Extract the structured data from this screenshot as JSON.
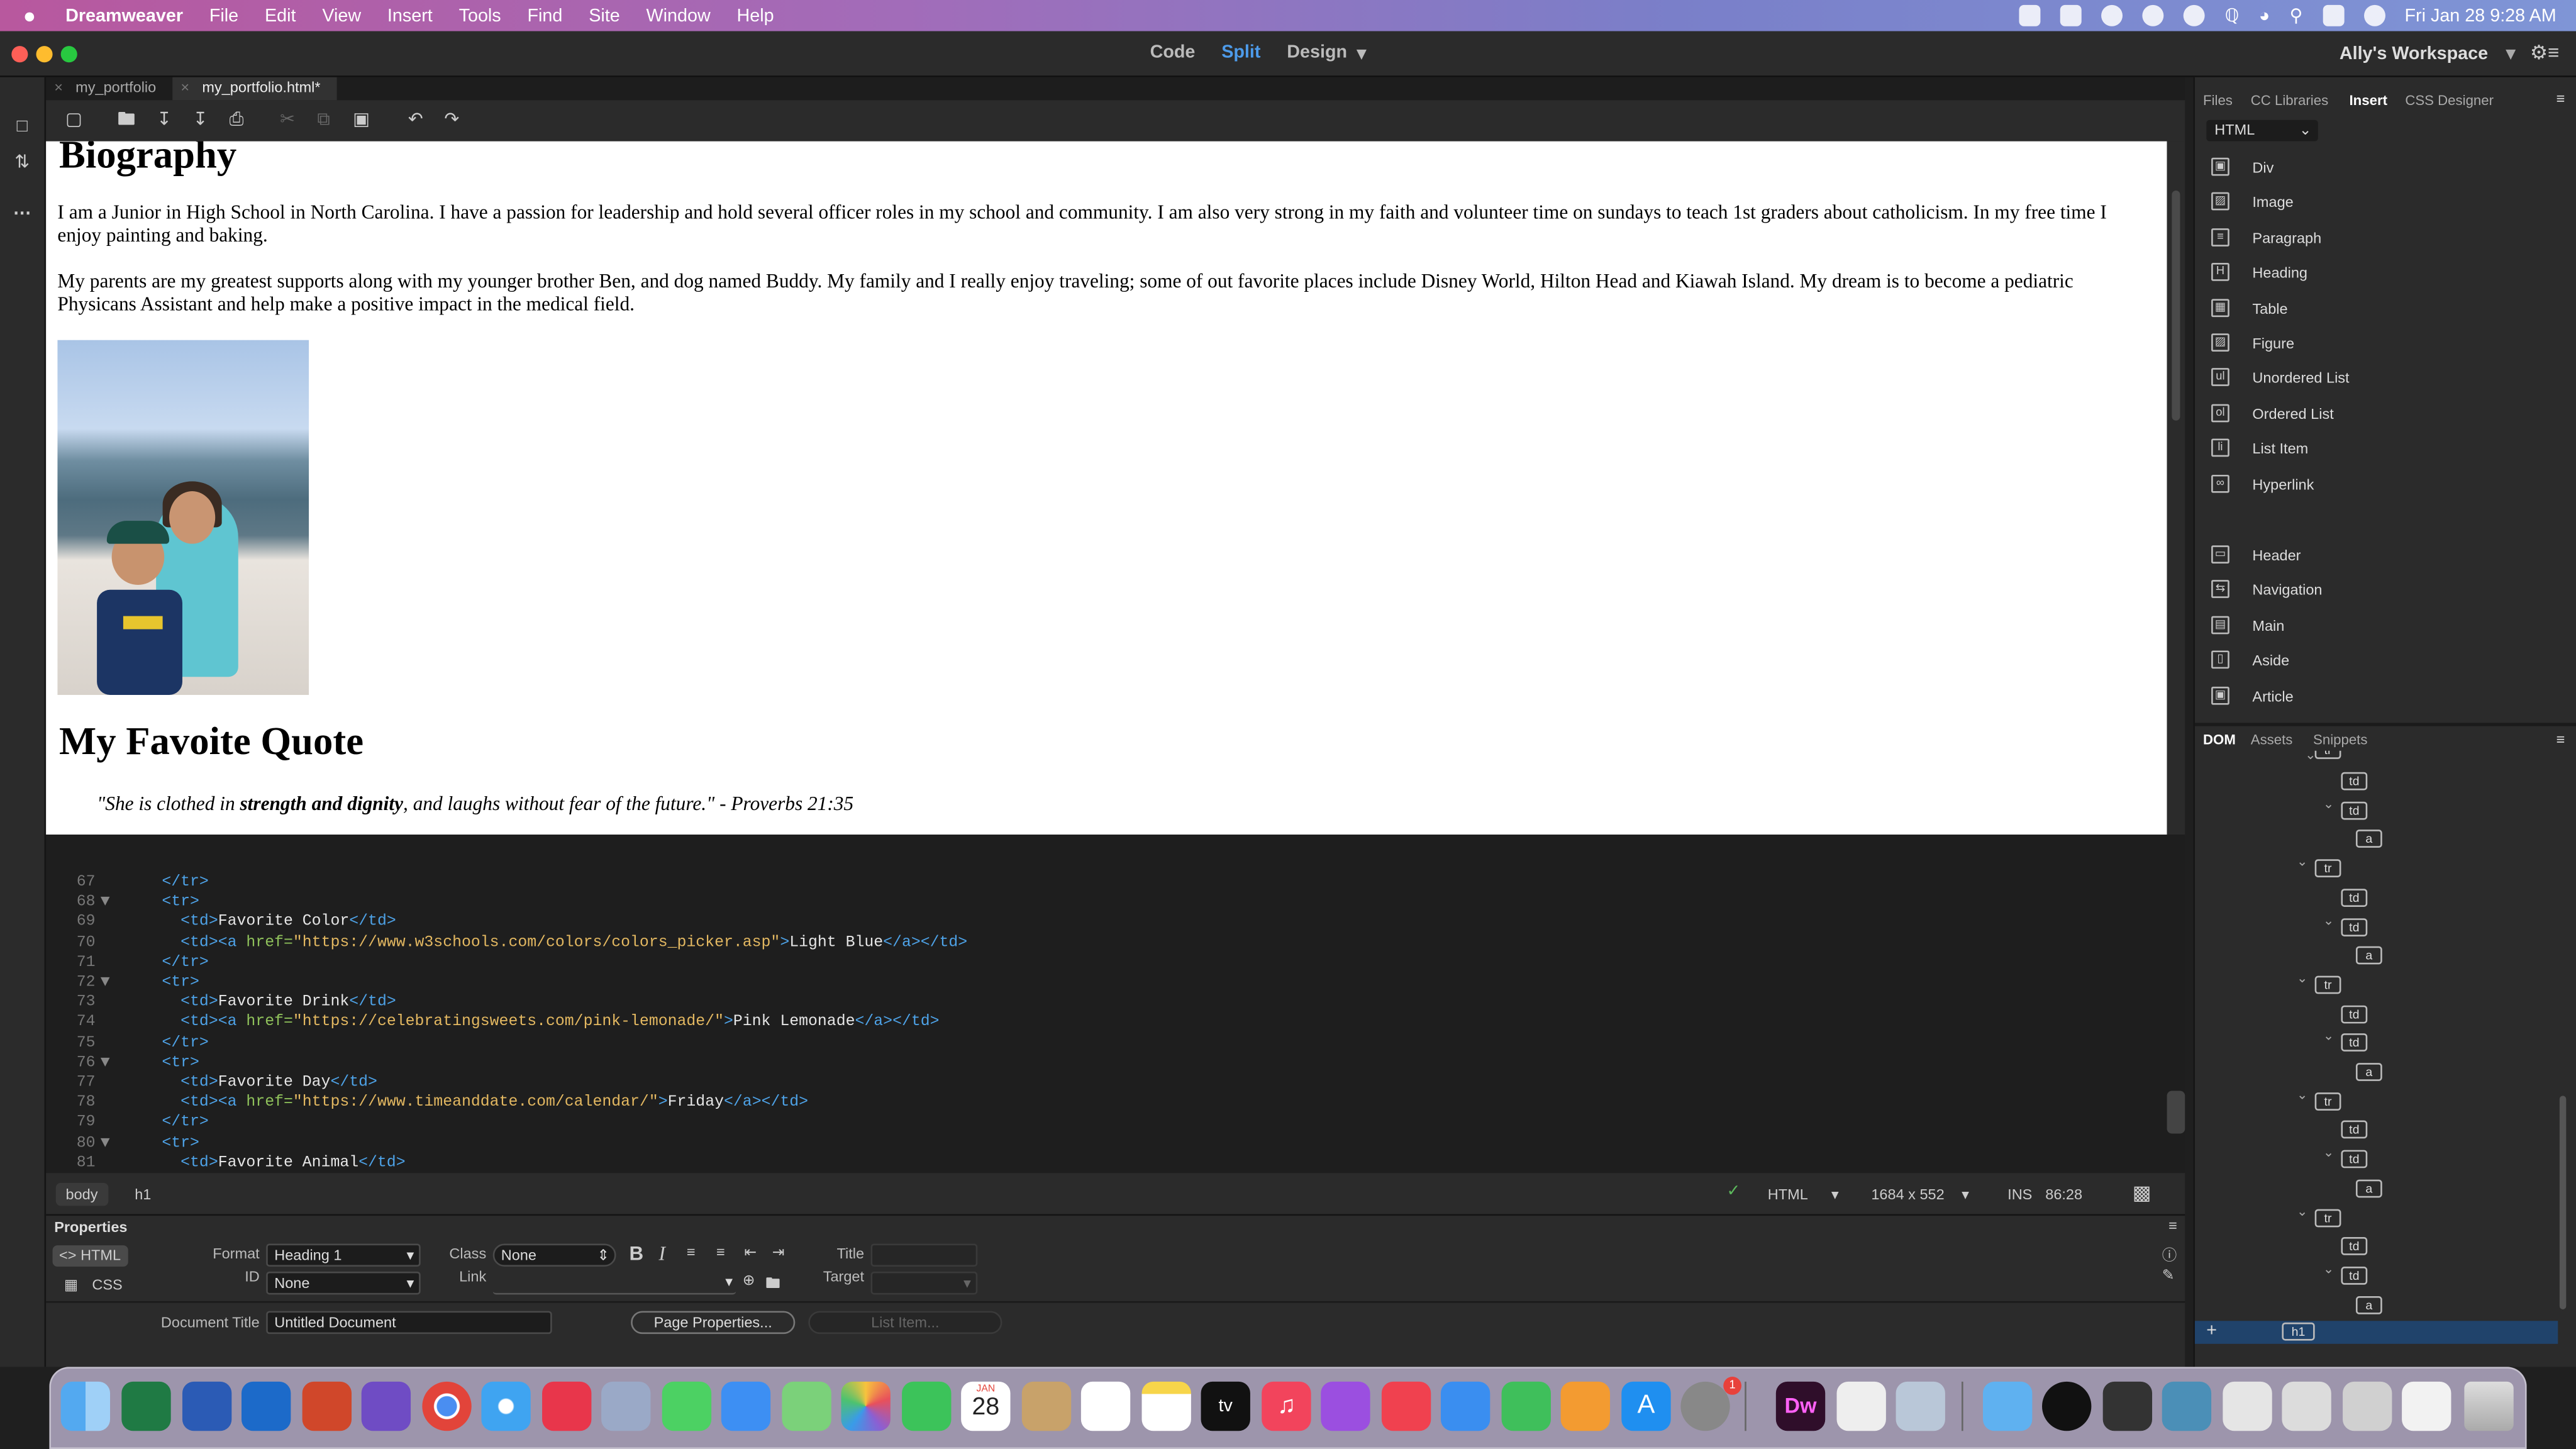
{
  "menubar": {
    "app": "Dreamweaver",
    "items": [
      "File",
      "Edit",
      "View",
      "Insert",
      "Tools",
      "Find",
      "Site",
      "Window",
      "Help"
    ],
    "clock": "Fri Jan 28  9:28 AM"
  },
  "titlebar": {
    "views": [
      "Code",
      "Split",
      "Design"
    ],
    "active_view": "Split",
    "workspace": "Ally's Workspace"
  },
  "tabs": [
    {
      "label": "my_portfolio"
    },
    {
      "label": "my_portfolio.html*"
    }
  ],
  "design": {
    "h_bio": "Biography",
    "p1": "I am a Junior in High School in North Carolina. I have a passion for leadership and hold several officer roles in my school and community. I am also very strong in my faith and volunteer time on sundays to teach 1st graders about catholicism. In my free time I enjoy painting and baking.",
    "p2": "My parents are my greatest supports along with my younger brother Ben, and dog named Buddy. My family and I really enjoy traveling; some of out favorite places include Disney World, Hilton Head and Kiawah Island. My dream is to become a pediatric Physicans Assistant and help make a positive impact in the medical field.",
    "h_quote": "My Favoite Quote",
    "quote_a": "\"She is clothed in ",
    "quote_b": "strength and dignity",
    "quote_c": ", and laughs without fear of the future.\" - Proverbs 21:35"
  },
  "code_lines": [
    {
      "n": "67",
      "fold": "",
      "parts": [
        [
          "t",
          "    "
        ],
        [
          "g",
          "</tr>"
        ]
      ]
    },
    {
      "n": "68",
      "fold": "▼",
      "parts": [
        [
          "t",
          "    "
        ],
        [
          "g",
          "<tr>"
        ]
      ]
    },
    {
      "n": "69",
      "fold": "",
      "parts": [
        [
          "t",
          "      "
        ],
        [
          "g",
          "<td>"
        ],
        [
          "t",
          "Favorite Color"
        ],
        [
          "g",
          "</td>"
        ]
      ]
    },
    {
      "n": "70",
      "fold": "",
      "parts": [
        [
          "t",
          "      "
        ],
        [
          "g",
          "<td><a "
        ],
        [
          "a",
          "href="
        ],
        [
          "s",
          "\"https://www.w3schools.com/colors/colors_picker.asp\""
        ],
        [
          "g",
          ">"
        ],
        [
          "t",
          "Light Blue"
        ],
        [
          "g",
          "</a></td>"
        ]
      ]
    },
    {
      "n": "71",
      "fold": "",
      "parts": [
        [
          "t",
          "    "
        ],
        [
          "g",
          "</tr>"
        ]
      ]
    },
    {
      "n": "72",
      "fold": "▼",
      "parts": [
        [
          "t",
          "    "
        ],
        [
          "g",
          "<tr>"
        ]
      ]
    },
    {
      "n": "73",
      "fold": "",
      "parts": [
        [
          "t",
          "      "
        ],
        [
          "g",
          "<td>"
        ],
        [
          "t",
          "Favorite Drink"
        ],
        [
          "g",
          "</td>"
        ]
      ]
    },
    {
      "n": "74",
      "fold": "",
      "parts": [
        [
          "t",
          "      "
        ],
        [
          "g",
          "<td><a "
        ],
        [
          "a",
          "href="
        ],
        [
          "s",
          "\"https://celebratingsweets.com/pink-lemonade/\""
        ],
        [
          "g",
          ">"
        ],
        [
          "t",
          "Pink Lemonade"
        ],
        [
          "g",
          "</a></td>"
        ]
      ]
    },
    {
      "n": "75",
      "fold": "",
      "parts": [
        [
          "t",
          "    "
        ],
        [
          "g",
          "</tr>"
        ]
      ]
    },
    {
      "n": "76",
      "fold": "▼",
      "parts": [
        [
          "t",
          "    "
        ],
        [
          "g",
          "<tr>"
        ]
      ]
    },
    {
      "n": "77",
      "fold": "",
      "parts": [
        [
          "t",
          "      "
        ],
        [
          "g",
          "<td>"
        ],
        [
          "t",
          "Favorite Day"
        ],
        [
          "g",
          "</td>"
        ]
      ]
    },
    {
      "n": "78",
      "fold": "",
      "parts": [
        [
          "t",
          "      "
        ],
        [
          "g",
          "<td><a "
        ],
        [
          "a",
          "href="
        ],
        [
          "s",
          "\"https://www.timeanddate.com/calendar/\""
        ],
        [
          "g",
          ">"
        ],
        [
          "t",
          "Friday"
        ],
        [
          "g",
          "</a></td>"
        ]
      ]
    },
    {
      "n": "79",
      "fold": "",
      "parts": [
        [
          "t",
          "    "
        ],
        [
          "g",
          "</tr>"
        ]
      ]
    },
    {
      "n": "80",
      "fold": "▼",
      "parts": [
        [
          "t",
          "    "
        ],
        [
          "g",
          "<tr>"
        ]
      ]
    },
    {
      "n": "81",
      "fold": "",
      "parts": [
        [
          "t",
          "      "
        ],
        [
          "g",
          "<td>"
        ],
        [
          "t",
          "Favorite Animal"
        ],
        [
          "g",
          "</td>"
        ]
      ]
    }
  ],
  "status": {
    "tag_body": "body",
    "tag_h1": "h1",
    "doc_type": "HTML",
    "size": "1684 x 552",
    "mode": "INS",
    "cursor": "86:28"
  },
  "props": {
    "title": "Properties",
    "html_btn": "HTML",
    "css_btn": "CSS",
    "format_label": "Format",
    "format_value": "Heading 1",
    "id_label": "ID",
    "id_value": "None",
    "class_label": "Class",
    "class_value": "None",
    "link_label": "Link",
    "title_label": "Title",
    "target_label": "Target",
    "doc_title_label": "Document Title",
    "doc_title_value": "Untitled Document",
    "page_props_btn": "Page Properties...",
    "list_item_btn": "List Item..."
  },
  "right": {
    "tabs": [
      "Files",
      "CC Libraries",
      "Insert",
      "CSS Designer"
    ],
    "active_tab": "Insert",
    "insert_select": "HTML",
    "insert_items": [
      {
        "label": "Div",
        "icon": "div-icon",
        "glyph": "▣"
      },
      {
        "label": "Image",
        "icon": "image-icon",
        "glyph": "▨"
      },
      {
        "label": "Paragraph",
        "icon": "paragraph-icon",
        "glyph": "≡"
      },
      {
        "label": "Heading",
        "icon": "heading-icon",
        "glyph": "H"
      },
      {
        "label": "Table",
        "icon": "table-icon",
        "glyph": "▦"
      },
      {
        "label": "Figure",
        "icon": "figure-icon",
        "glyph": "▨"
      },
      {
        "label": "Unordered List",
        "icon": "unordered-list-icon",
        "glyph": "ul"
      },
      {
        "label": "Ordered List",
        "icon": "ordered-list-icon",
        "glyph": "ol"
      },
      {
        "label": "List Item",
        "icon": "list-item-icon",
        "glyph": "li"
      },
      {
        "label": "Hyperlink",
        "icon": "hyperlink-icon",
        "glyph": "∞"
      }
    ],
    "insert_items2": [
      {
        "label": "Header",
        "icon": "header-icon",
        "glyph": "▭"
      },
      {
        "label": "Navigation",
        "icon": "navigation-icon",
        "glyph": "⇆"
      },
      {
        "label": "Main",
        "icon": "main-icon",
        "glyph": "▤"
      },
      {
        "label": "Aside",
        "icon": "aside-icon",
        "glyph": "▯"
      },
      {
        "label": "Article",
        "icon": "article-icon",
        "glyph": "▣"
      }
    ],
    "bottom_tabs": [
      "DOM",
      "Assets",
      "Snippets"
    ],
    "active_bottom": "DOM",
    "dom_nodes": [
      {
        "tag": "td",
        "lvl": 2
      },
      {
        "tag": "td",
        "lvl": 2,
        "car": true
      },
      {
        "tag": "a",
        "lvl": 3
      },
      {
        "tag": "tr",
        "lvl": 1,
        "car": true
      },
      {
        "tag": "td",
        "lvl": 2
      },
      {
        "tag": "td",
        "lvl": 2,
        "car": true
      },
      {
        "tag": "a",
        "lvl": 3
      },
      {
        "tag": "tr",
        "lvl": 1,
        "car": true
      },
      {
        "tag": "td",
        "lvl": 2
      },
      {
        "tag": "td",
        "lvl": 2,
        "car": true
      },
      {
        "tag": "a",
        "lvl": 3
      },
      {
        "tag": "tr",
        "lvl": 1,
        "car": true
      },
      {
        "tag": "td",
        "lvl": 2
      },
      {
        "tag": "td",
        "lvl": 2,
        "car": true
      },
      {
        "tag": "a",
        "lvl": 3
      },
      {
        "tag": "tr",
        "lvl": 1,
        "car": true
      },
      {
        "tag": "td",
        "lvl": 2
      },
      {
        "tag": "td",
        "lvl": 2,
        "car": true
      },
      {
        "tag": "a",
        "lvl": 3
      }
    ],
    "dom_selected": "h1"
  },
  "dock": {
    "calendar_month": "JAN",
    "calendar_day": "28",
    "badge": "1",
    "tv_label": "tv",
    "dw_label": "Dw"
  },
  "colors": {
    "accent": "#4d9bea",
    "panel": "#2b2b2b",
    "code_tag": "#4ea3e8",
    "code_attr": "#8fc15b",
    "code_string": "#e3b861"
  }
}
